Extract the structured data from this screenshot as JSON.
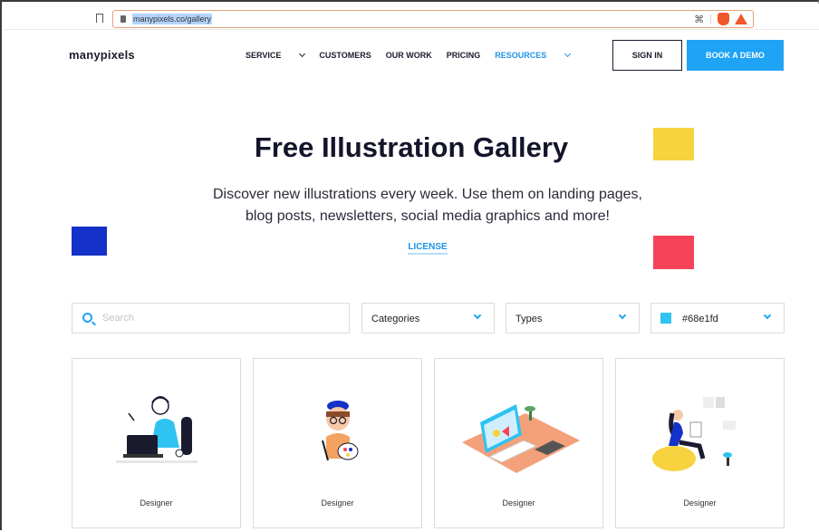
{
  "browser": {
    "url": "manypixels.co/gallery"
  },
  "header": {
    "logo": "manypixels",
    "nav": [
      {
        "label": "SERVICE",
        "dropdown": true,
        "active": false
      },
      {
        "label": "CUSTOMERS",
        "dropdown": false,
        "active": false
      },
      {
        "label": "OUR WORK",
        "dropdown": false,
        "active": false
      },
      {
        "label": "PRICING",
        "dropdown": false,
        "active": false
      },
      {
        "label": "RESOURCES",
        "dropdown": true,
        "active": true
      }
    ],
    "sign_in": "SIGN IN",
    "book_demo": "BOOK A DEMO"
  },
  "hero": {
    "title": "Free Illustration Gallery",
    "subtitle": "Discover new illustrations every week. Use them on landing pages, blog posts, newsletters, social media graphics and more!",
    "license_link": "LICENSE"
  },
  "filters": {
    "search_placeholder": "Search",
    "search_value": "",
    "categories": "Categories",
    "types": "Types",
    "color": "#68e1fd",
    "color_swatch": "#2ec3f0"
  },
  "cards": [
    {
      "caption": "Designer",
      "icon": "designer-at-laptop-illustration"
    },
    {
      "caption": "Designer",
      "icon": "designer-with-palette-illustration"
    },
    {
      "caption": "Designer",
      "icon": "designer-desk-isometric-illustration"
    },
    {
      "caption": "Designer",
      "icon": "designer-on-beanbag-illustration"
    }
  ],
  "colors": {
    "accent": "#1fa3f5",
    "yellow": "#f6d33f",
    "blue": "#1432c9",
    "red": "#f74359"
  }
}
